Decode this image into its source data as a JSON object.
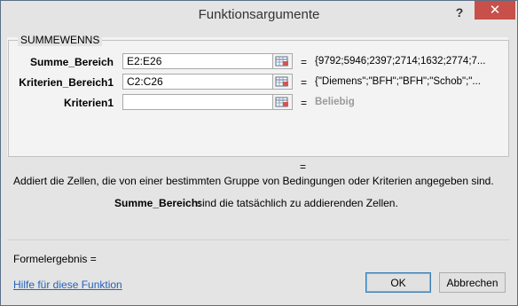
{
  "window": {
    "title": "Funktionsargumente",
    "help_label": "?",
    "close_label": "✕"
  },
  "function": {
    "name": "SUMMEWENNS",
    "args": [
      {
        "label": "Summe_Bereich",
        "value": "E2:E26",
        "preview": "{9792;5946;2397;2714;1632;2774;7..."
      },
      {
        "label": "Kriterien_Bereich1",
        "value": "C2:C26",
        "preview": "{\"Diemens\";\"BFH\";\"BFH\";\"Schob\";\"..."
      },
      {
        "label": "Kriterien1",
        "value": "",
        "preview": "Beliebig"
      }
    ],
    "equals": "="
  },
  "description": "Addiert die Zellen, die von einer bestimmten Gruppe von Bedingungen oder Kriterien angegeben sind.",
  "argument_help": {
    "name": "Summe_Bereich:",
    "text": "sind die tatsächlich zu addierenden Zellen."
  },
  "formula_result_label": "Formelergebnis =",
  "help_link": "Hilfe für diese Funktion",
  "buttons": {
    "ok": "OK",
    "cancel": "Abbrechen"
  },
  "colors": {
    "close_button": "#c7504a",
    "link": "#2563bc"
  },
  "icons": {
    "range_picker": "range-picker-icon"
  }
}
